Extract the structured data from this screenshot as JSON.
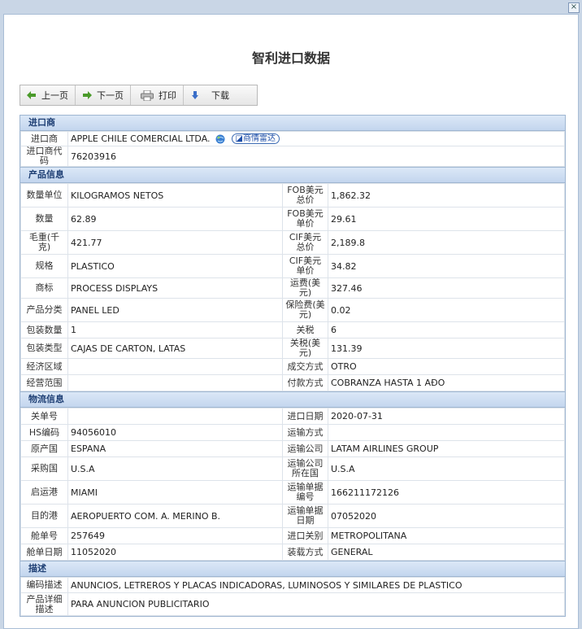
{
  "window": {
    "close_label": "×"
  },
  "title": "智利进口数据",
  "toolbar": {
    "prev": "上一页",
    "next": "下一页",
    "print": "打印",
    "download": "下载"
  },
  "importer": {
    "section": "进口商",
    "name_label": "进口商",
    "name": "APPLE CHILE COMERCIAL LTDA.",
    "radar_label": "商情雷达",
    "code_label": "进口商代码",
    "code": "76203916"
  },
  "product": {
    "section": "产品信息",
    "rows": [
      {
        "l1": "数量单位",
        "v1": "KILOGRAMOS NETOS",
        "l2": "FOB美元总价",
        "v2": "1,862.32"
      },
      {
        "l1": "数量",
        "v1": "62.89",
        "l2": "FOB美元单价",
        "v2": "29.61"
      },
      {
        "l1": "毛重(千克)",
        "v1": "421.77",
        "l2": "CIF美元总价",
        "v2": "2,189.8"
      },
      {
        "l1": "规格",
        "v1": "PLASTICO",
        "l2": "CIF美元单价",
        "v2": "34.82"
      },
      {
        "l1": "商标",
        "v1": "PROCESS DISPLAYS",
        "l2": "运费(美元)",
        "v2": "327.46"
      },
      {
        "l1": "产品分类",
        "v1": "PANEL LED",
        "l2": "保险费(美元)",
        "v2": "0.02"
      },
      {
        "l1": "包装数量",
        "v1": "1",
        "l2": "关税",
        "v2": "6"
      },
      {
        "l1": "包装类型",
        "v1": "CAJAS DE CARTON, LATAS",
        "l2": "关税(美元)",
        "v2": "131.39"
      },
      {
        "l1": "经济区域",
        "v1": "",
        "l2": "成交方式",
        "v2": "OTRO"
      },
      {
        "l1": "经营范围",
        "v1": "",
        "l2": "付款方式",
        "v2": "COBRANZA HASTA 1 AÐO"
      }
    ]
  },
  "logistics": {
    "section": "物流信息",
    "rows": [
      {
        "l1": "关单号",
        "v1": "",
        "l2": "进口日期",
        "v2": "2020-07-31"
      },
      {
        "l1": "HS编码",
        "v1": "94056010",
        "l2": "运输方式",
        "v2": ""
      },
      {
        "l1": "原产国",
        "v1": "ESPANA",
        "l2": "运输公司",
        "v2": "LATAM AIRLINES GROUP"
      },
      {
        "l1": "采购国",
        "v1": "U.S.A",
        "l2": "运输公司所在国",
        "v2": "U.S.A"
      },
      {
        "l1": "启运港",
        "v1": "MIAMI",
        "l2": "运输单据编号",
        "v2": "166211172126"
      },
      {
        "l1": "目的港",
        "v1": "AEROPUERTO COM. A. MERINO B.",
        "l2": "运输单据日期",
        "v2": "07052020"
      },
      {
        "l1": "舱单号",
        "v1": "257649",
        "l2": "进口关别",
        "v2": "METROPOLITANA"
      },
      {
        "l1": "舱单日期",
        "v1": "11052020",
        "l2": "装载方式",
        "v2": "GENERAL"
      }
    ]
  },
  "description": {
    "section": "描述",
    "code_label": "编码描述",
    "code_desc": "ANUNCIOS, LETREROS Y PLACAS INDICADORAS, LUMINOSOS Y SIMILARES DE PLASTICO",
    "detail_label": "产品详细描述",
    "detail": "PARA ANUNCION PUBLICITARIO"
  },
  "colors": {
    "section_text": "#1e3f74",
    "border": "#9fb6d1",
    "background": "#c9d6e6"
  }
}
